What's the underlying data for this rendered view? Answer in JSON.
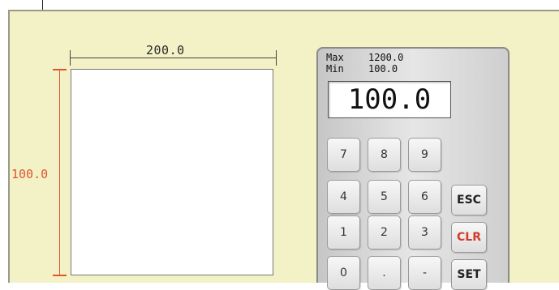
{
  "dimensions": {
    "width_label": "200.0",
    "height_label": "100.0"
  },
  "keypad": {
    "max_label": "Max",
    "max_value": "1200.0",
    "min_label": "Min",
    "min_value": "100.0",
    "display_value": "100.0",
    "digit_keys": [
      "7",
      "8",
      "9",
      "4",
      "5",
      "6",
      "1",
      "2",
      "3",
      "0",
      ".",
      "-"
    ],
    "esc_label": "ESC",
    "clr_label": "CLR",
    "set_label": "SET"
  },
  "colors": {
    "screen_bg": "#f2f2c6",
    "height_dimension": "#e05530",
    "clr_text": "#d43a2a"
  }
}
